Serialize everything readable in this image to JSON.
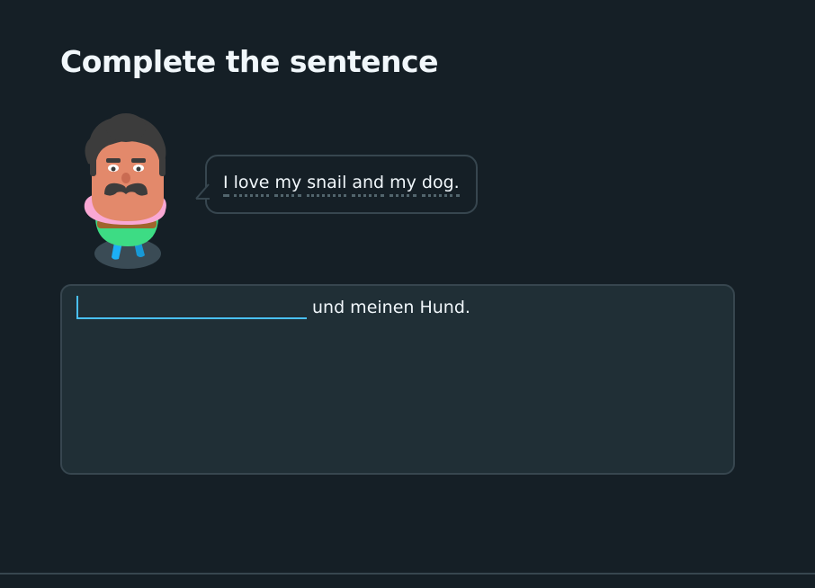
{
  "challenge": {
    "title": "Complete the sentence"
  },
  "prompt": {
    "words": [
      "I",
      "love",
      "my",
      "snail",
      "and",
      "my",
      "dog."
    ]
  },
  "answer": {
    "input_value": "",
    "sentence_suffix": "und meinen Hund."
  },
  "colors": {
    "background": "#151f26",
    "panel": "#202f36",
    "border": "#37464f",
    "accent_input": "#49c0f8",
    "text": "#f1f7fb"
  },
  "icons": {
    "character": "mustache-man-character-icon"
  }
}
